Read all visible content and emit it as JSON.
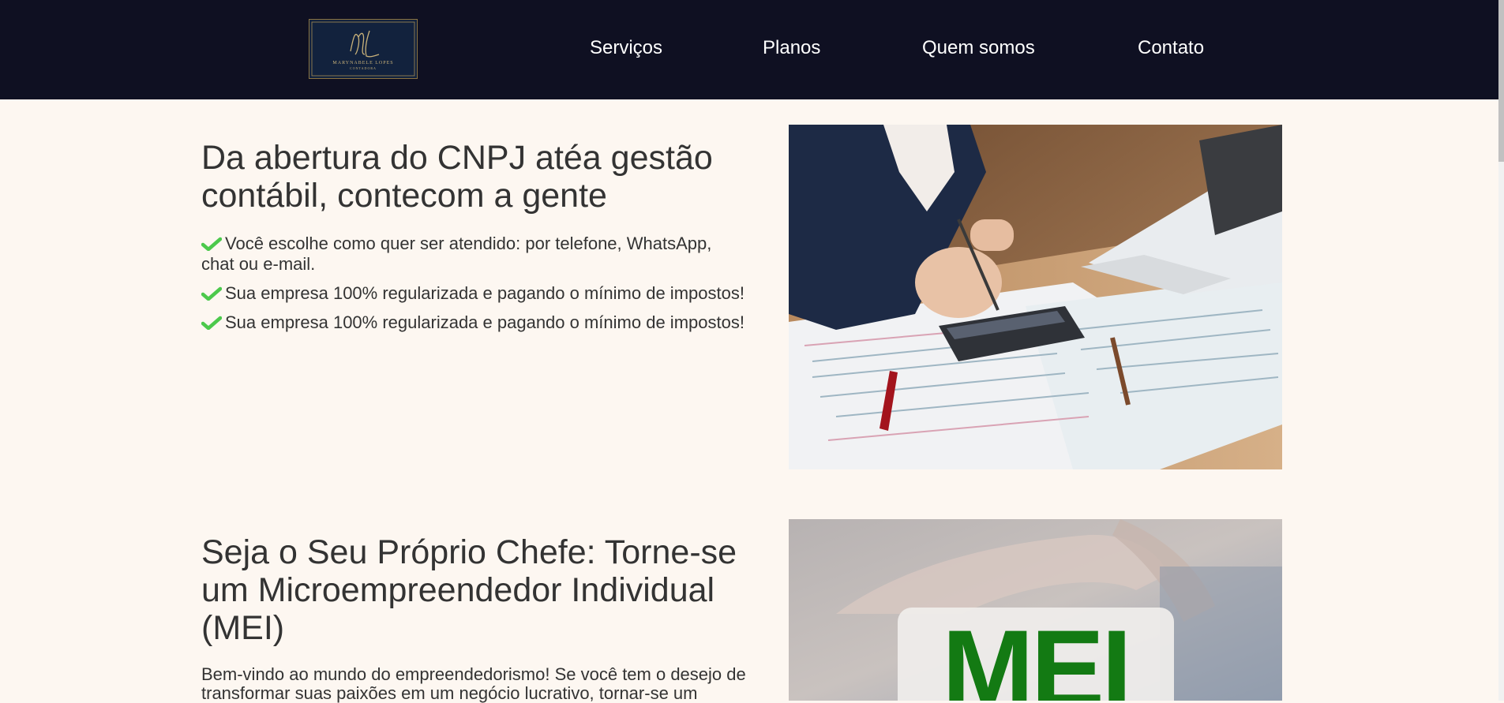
{
  "header": {
    "logo_text": "MARYNABELE LOPES",
    "logo_subtext": "CONTADORA",
    "logo_monogram": "ML",
    "nav": [
      {
        "label": "Serviços"
      },
      {
        "label": "Planos"
      },
      {
        "label": "Quem somos"
      },
      {
        "label": "Contato"
      }
    ]
  },
  "hero": {
    "title": "Da abertura do CNPJ atéa gestão contábil, contecom a gente",
    "checks": [
      "Você escolhe como quer ser atendido: por telefone, WhatsApp, chat ou e-mail.",
      "Sua empresa 100% regularizada e pagando o mínimo de impostos!",
      "Sua empresa 100% regularizada e pagando o mínimo de impostos!"
    ],
    "check_icon": "check-icon",
    "check_color": "#4cc94c"
  },
  "mei": {
    "title": "Seja o Seu Próprio Chefe: Torne-se um Microempreendedor Individual (MEI)",
    "paragraph": "Bem-vindo ao mundo do empreendedorismo! Se você tem o desejo de transformar suas paixões em um negócio lucrativo, tornar-se um",
    "image_text": "MEI"
  },
  "colors": {
    "header_bg": "#0f1022",
    "page_bg": "#fdf7f1",
    "text": "#333333",
    "mei_green": "#137a13"
  }
}
